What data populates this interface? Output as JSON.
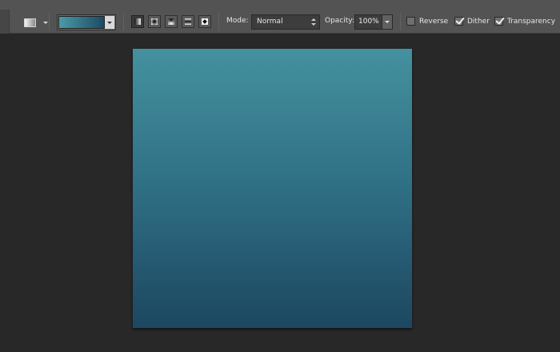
{
  "options_bar": {
    "tool_preset_icon": "gradient-tool-preset-icon",
    "gradient": {
      "colors": [
        "#4a9aa8",
        "#1c4b63"
      ]
    },
    "gradient_types": [
      {
        "name": "linear-gradient-icon",
        "active": true
      },
      {
        "name": "radial-gradient-icon",
        "active": false
      },
      {
        "name": "angle-gradient-icon",
        "active": false
      },
      {
        "name": "reflected-gradient-icon",
        "active": false
      },
      {
        "name": "diamond-gradient-icon",
        "active": false
      }
    ],
    "mode_label": "Mode:",
    "mode_value": "Normal",
    "opacity_label": "Opacity:",
    "opacity_value": "100%",
    "reverse_label": "Reverse",
    "reverse_checked": false,
    "dither_label": "Dither",
    "dither_checked": true,
    "transparency_label": "Transparency",
    "transparency_checked": true
  },
  "canvas": {
    "gradient_colors": [
      "#44919f",
      "#2f6f84",
      "#1d4761"
    ],
    "direction": "top-to-bottom"
  },
  "colors": {
    "toolbar_bg": "#535353",
    "workspace_bg": "#282828"
  }
}
